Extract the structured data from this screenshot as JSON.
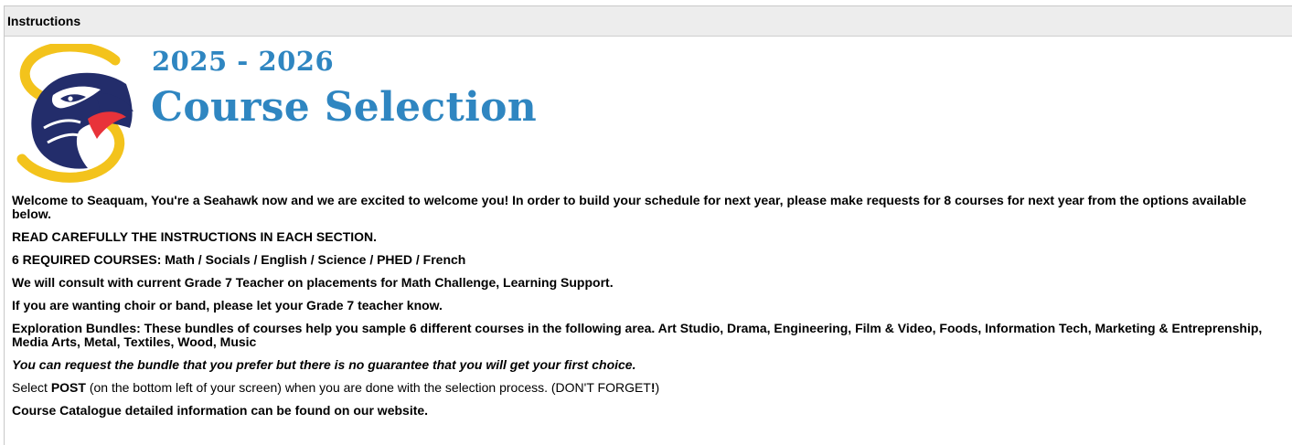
{
  "panel": {
    "header": "Instructions"
  },
  "hero": {
    "logo": "seaquam-seahawk-logo",
    "year": "2025 - 2026",
    "title": "Course Selection",
    "brand_blue": "#2f86c1",
    "logo_navy": "#232d6b",
    "logo_gold": "#f3c31c",
    "logo_red": "#e8333a"
  },
  "instructions": {
    "welcome": "Welcome to Seaquam, You're a Seahawk now and we are excited to welcome you!  In order to build your schedule for next year, please make requests for 8 courses for next year from the options available below.",
    "read_carefully": "READ CAREFULLY THE INSTRUCTIONS IN EACH SECTION.",
    "required": "6 REQUIRED COURSES:   Math / Socials / English / Science / PHED / French",
    "consult": "We will consult with current Grade 7 Teacher on placements for Math Challenge, Learning Support.",
    "choir": "If you are wanting choir or band, please let your Grade 7 teacher know.",
    "exploration": "Exploration Bundles:   These bundles of courses help you sample 6 different courses in the following area.  Art Studio, Drama, Engineering, Film & Video, Foods, Information Tech, Marketing & Entreprenship, Media Arts, Metal, Textiles, Wood, Music",
    "guarantee": "You can request the bundle that you prefer but there is no guarantee that you will get your first choice.",
    "post_prefix": "Select ",
    "post_bold": "POST",
    "post_middle": " (on the bottom left of your screen) when you are done with the selection process. (DON'T FORGET",
    "post_bang": "!",
    "post_end": ")",
    "catalogue": "Course Catalogue detailed information can be found on our website."
  }
}
